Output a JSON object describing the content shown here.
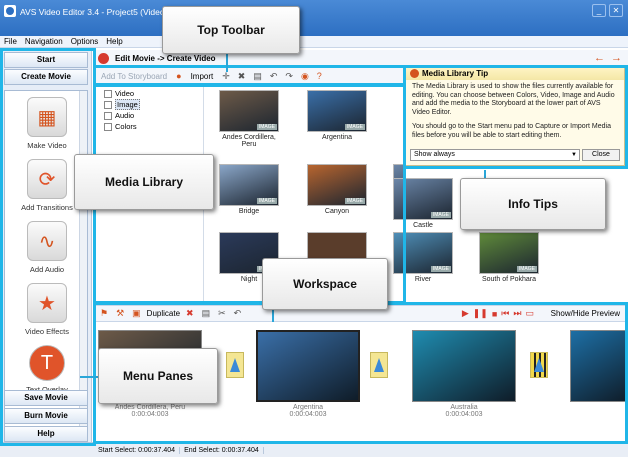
{
  "window": {
    "title": "AVS Video Editor 3.4 - Project5 (Video - ... 300 Hz, Stereo)"
  },
  "menu": [
    "File",
    "Navigation",
    "Options",
    "Help"
  ],
  "header": {
    "breadcrumb": "Edit Movie -> Create Video"
  },
  "sidebar": {
    "start": "Start",
    "create_movie": "Create Movie",
    "items": [
      {
        "label": "Make Video",
        "icon": "film-icon"
      },
      {
        "label": "Add Transitions",
        "icon": "transitions-icon"
      },
      {
        "label": "Add Audio",
        "icon": "audio-icon"
      },
      {
        "label": "Video Effects",
        "icon": "effects-icon"
      },
      {
        "label": "Text Overlay",
        "icon": "text-icon"
      }
    ],
    "save_movie": "Save Movie",
    "burn_movie": "Burn Movie",
    "help": "Help"
  },
  "toolbar": {
    "add_to_storyboard": "Add To Storyboard",
    "import": "Import"
  },
  "tree": [
    "Video",
    "Image",
    "Audio",
    "Colors"
  ],
  "library": [
    {
      "name": "Andes Cordillera, Peru",
      "color": "#6d5a48"
    },
    {
      "name": "Argentina",
      "color": "#3a6fa8"
    },
    {
      "name": "Bridge",
      "color": "#8aa6c8"
    },
    {
      "name": "Canyon",
      "color": "#b8652f"
    },
    {
      "name": "Castle",
      "color": "#6b86a8"
    },
    {
      "name": "Night",
      "color": "#2b3a5a"
    },
    {
      "name": "River",
      "color": "#4f8fb8"
    },
    {
      "name": "South of Pokhara",
      "color": "#5f8a3a"
    }
  ],
  "tip": {
    "title": "Media Library Tip",
    "p1": "The Media Library is used to show the files currently available for editing. You can choose between Colors, Video, Image and Audio and add the media to the Storyboard at the lower part of AVS Video Editor.",
    "p2": "You should go to the Start menu pad to Capture or Import Media files before you will be able to start editing them.",
    "select": "Show always",
    "close": "Close"
  },
  "ws_toolbar": {
    "duplicate": "Duplicate",
    "show_hide": "Show/Hide Preview"
  },
  "storyboard": [
    {
      "name": "Andes Cordillera, Peru",
      "time": "0:00:04:003",
      "color": "#6d5a48"
    },
    {
      "name": "Argentina",
      "time": "0:00:04:003",
      "color": "#3a6fa8"
    },
    {
      "name": "Australia",
      "time": "0:00:04:003",
      "color": "#1f8cb0"
    },
    {
      "name": "",
      "time": "",
      "color": "#1d6fa5"
    }
  ],
  "status": {
    "start_select": "Start Select: 0:00:37.404",
    "end_select": "End Select: 0:00:37.404"
  },
  "callouts": {
    "top_toolbar": "Top Toolbar",
    "media_library": "Media Library",
    "info_tips": "Info Tips",
    "workspace": "Workspace",
    "menu_panes": "Menu Panes"
  },
  "accent": "#20b6e8"
}
